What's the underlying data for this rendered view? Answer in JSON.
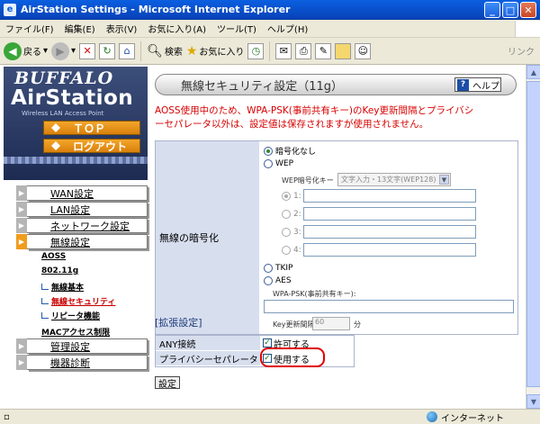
{
  "window": {
    "title": "AirStation Settings - Microsoft Internet Explorer"
  },
  "menubar": [
    "ファイル(F)",
    "編集(E)",
    "表示(V)",
    "お気に入り(A)",
    "ツール(T)",
    "ヘルプ(H)"
  ],
  "toolbar": {
    "back": "戻る",
    "search": "検索",
    "favorites": "お気に入り",
    "links": "リンク"
  },
  "sidebar": {
    "brand": "BUFFALO",
    "product": "AirStation",
    "tagline": "Wireless LAN Access Point",
    "top_button": "ＴＯＰ",
    "logout_button": "ログアウト",
    "menu": [
      {
        "label": "WAN設定"
      },
      {
        "label": "LAN設定"
      },
      {
        "label": "ネットワーク設定"
      },
      {
        "label": "無線設定"
      }
    ],
    "wireless_sub": {
      "aoss": "AOSS",
      "band": "802.11g",
      "basic": "無線基本",
      "security": "無線セキュリティ",
      "repeater": "リピータ機能",
      "mac": "MACアクセス制限"
    },
    "menu2": [
      {
        "label": "管理設定"
      },
      {
        "label": "機器診断"
      }
    ]
  },
  "main": {
    "title": "無線セキュリティ設定（11g）",
    "help": "ヘルプ",
    "warning_line1": "AOSS使用中のため、WPA-PSK(事前共有キー)のKey更新間隔とプライバシ",
    "warning_line2": "ーセパレータ以外は、設定値は保存されますが使用されません。",
    "encryption_label": "無線の暗号化",
    "opt_none": "暗号化なし",
    "opt_wep": "WEP",
    "wep_key_label": "WEP暗号化キー",
    "wep_key_select": "文字入力・13文字(WEP128)",
    "wep_keys": [
      "1:",
      "2:",
      "3:",
      "4:"
    ],
    "opt_tkip": "TKIP",
    "opt_aes": "AES",
    "psk_label": "WPA-PSK(事前共有キー):",
    "key_interval_label": "Key更新間隔:",
    "key_interval_value": "60",
    "key_interval_unit": "分",
    "extended_title": "[拡張設定]",
    "any_label": "ANY接続",
    "any_value": "許可する",
    "privacy_label": "プライバシーセパレータ",
    "privacy_value": "使用する",
    "submit": "設定"
  },
  "statusbar": {
    "zone": "インターネット"
  }
}
